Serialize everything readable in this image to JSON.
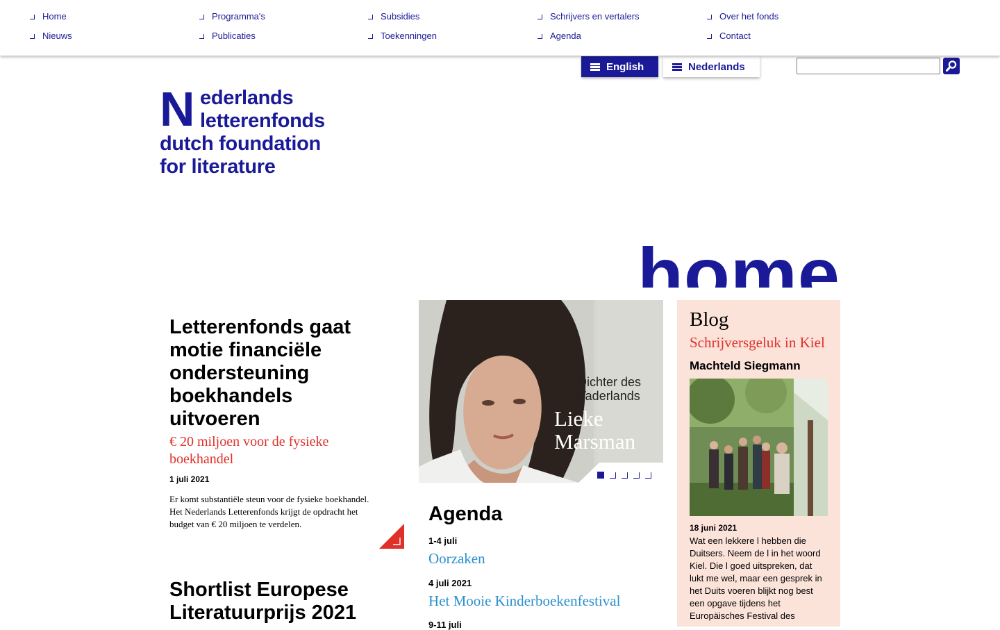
{
  "nav": {
    "items": [
      {
        "label": "Home"
      },
      {
        "label": "Programma's"
      },
      {
        "label": "Subsidies"
      },
      {
        "label": "Schrijvers en vertalers"
      },
      {
        "label": "Over het fonds"
      },
      {
        "label": "Nieuws"
      },
      {
        "label": "Publicaties"
      },
      {
        "label": "Toekenningen"
      },
      {
        "label": "Agenda"
      },
      {
        "label": "Contact"
      }
    ]
  },
  "languages": {
    "english": "English",
    "dutch": "Nederlands"
  },
  "search": {
    "value": ""
  },
  "logo": {
    "letter": "N",
    "line1": "ederlands",
    "line2": "letterenfonds",
    "line3": "dutch foundation",
    "line4": "for literature"
  },
  "page_title": "home",
  "news": {
    "title": "Letterenfonds gaat motie financiële ondersteuning boekhandels uitvoeren",
    "subtitle": "€ 20 miljoen voor de fysieke boekhandel",
    "date": "1 juli 2021",
    "text": "Er komt substantiële steun voor de fysieke boekhandel. Het Nederlands Letterenfonds krijgt de opdracht het budget van € 20 miljoen te verdelen.",
    "second_title": "Shortlist Europese Literatuurprijs 2021"
  },
  "feature": {
    "caption_small": "Dichter des Vaderlands",
    "caption_name": "Lieke Marsman",
    "dots_total": 5,
    "dots_active": 1
  },
  "agenda": {
    "heading": "Agenda",
    "items": [
      {
        "date": "1-4 juli",
        "title": "Oorzaken"
      },
      {
        "date": "4 juli 2021",
        "title": "Het Mooie Kinderboekenfestival"
      },
      {
        "date": "9-11 juli",
        "title": ""
      }
    ]
  },
  "blog": {
    "heading": "Blog",
    "subtitle": "Schrijversgeluk in Kiel",
    "author": "Machteld Siegmann",
    "date": "18 juni 2021",
    "text": "Wat een lekkere l hebben die Duitsers. Neem de l in het woord Kiel. Die l goed uitspreken, dat lukt me wel, maar een gesprek in het Duits voeren blijkt nog best een opgave tijdens het Europäisches Festival des"
  },
  "colors": {
    "brand_blue": "#1a1a99",
    "accent_red": "#e0302a",
    "link_blue": "#2a8fcf",
    "blog_bg": "#fce3da"
  }
}
